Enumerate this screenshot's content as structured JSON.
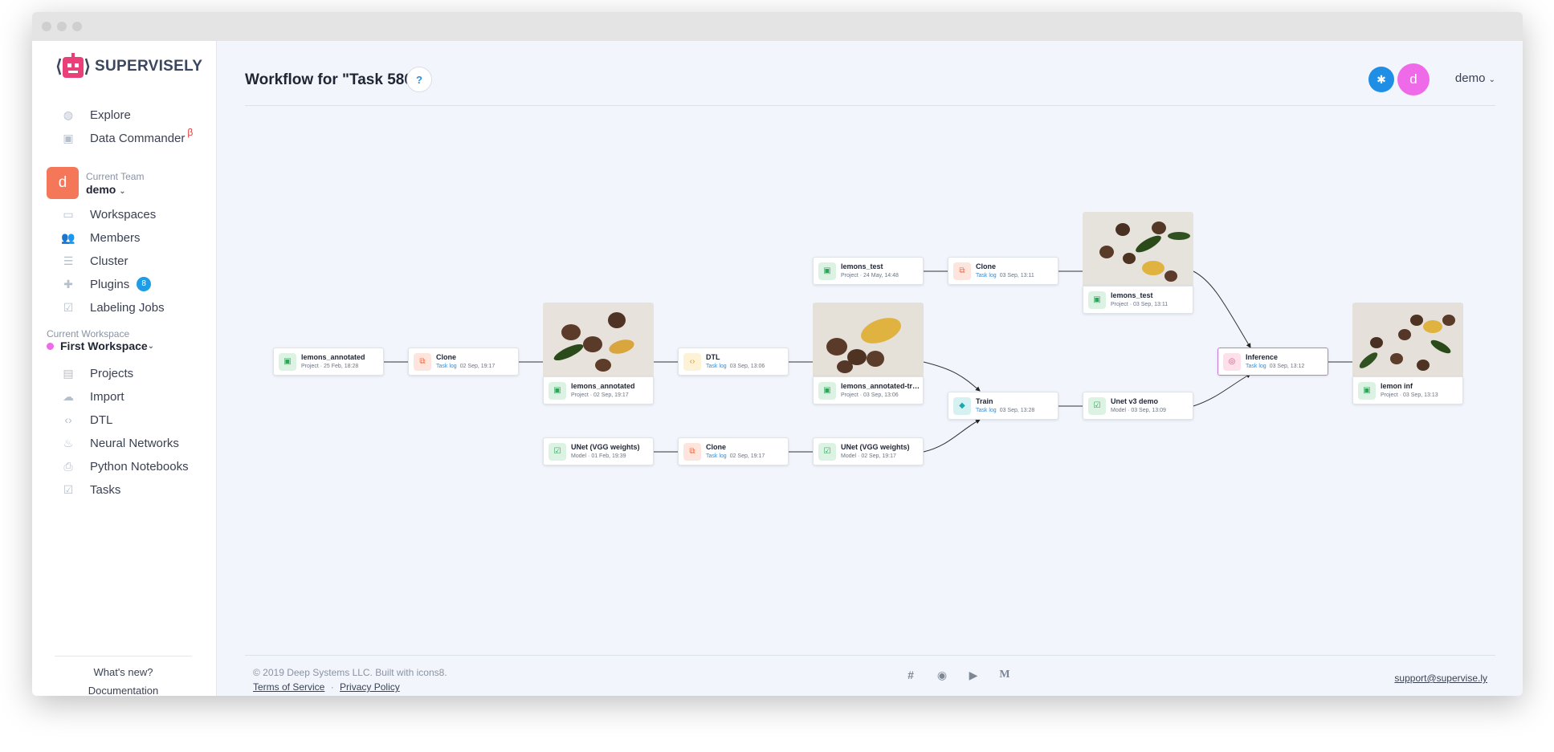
{
  "app": {
    "name": "SUPERVISELY"
  },
  "sidebar": {
    "top_items": [
      {
        "label": "Explore",
        "icon": "globe-icon"
      },
      {
        "label": "Data Commander",
        "icon": "folder-icon",
        "beta": "β"
      }
    ],
    "team": {
      "caption": "Current Team",
      "name": "demo",
      "avatar": "d"
    },
    "team_items": [
      {
        "label": "Workspaces",
        "icon": "monitor-icon"
      },
      {
        "label": "Members",
        "icon": "users-icon"
      },
      {
        "label": "Cluster",
        "icon": "cluster-icon"
      },
      {
        "label": "Plugins",
        "icon": "puzzle-icon",
        "badge": "8"
      },
      {
        "label": "Labeling Jobs",
        "icon": "check-icon"
      }
    ],
    "workspace": {
      "caption": "Current Workspace",
      "name": "First Workspace"
    },
    "workspace_items": [
      {
        "label": "Projects",
        "icon": "images-icon"
      },
      {
        "label": "Import",
        "icon": "cloud-upload-icon"
      },
      {
        "label": "DTL",
        "icon": "code-icon"
      },
      {
        "label": "Neural Networks",
        "icon": "flame-icon"
      },
      {
        "label": "Python Notebooks",
        "icon": "printer-icon"
      },
      {
        "label": "Tasks",
        "icon": "check-icon"
      }
    ],
    "footer": {
      "whats_new": "What's new?",
      "docs": "Documentation"
    }
  },
  "header": {
    "title": "Workflow for \"Task 580\"",
    "help": "?",
    "user_avatar": "d",
    "user_name": "demo"
  },
  "graph": {
    "nodes": [
      {
        "id": "n1",
        "title": "lemons_annotated",
        "kind": "Project",
        "date": "25 Feb, 18:28",
        "icon": "green"
      },
      {
        "id": "n2",
        "title": "Clone",
        "kind": "Task log",
        "date": "02 Sep, 19:17",
        "icon": "orange"
      },
      {
        "id": "n3",
        "title": "lemons_annotated",
        "kind": "Project",
        "date": "02 Sep, 19:17",
        "icon": "green"
      },
      {
        "id": "n4",
        "title": "DTL",
        "kind": "Task log",
        "date": "03 Sep, 13:06",
        "icon": "yellow"
      },
      {
        "id": "n5",
        "title": "lemons_annotated-trai...",
        "kind": "Project",
        "date": "03 Sep, 13:06",
        "icon": "green"
      },
      {
        "id": "n6",
        "title": "lemons_test",
        "kind": "Project",
        "date": "24 May, 14:48",
        "icon": "green"
      },
      {
        "id": "n7",
        "title": "Clone",
        "kind": "Task log",
        "date": "03 Sep, 13:11",
        "icon": "orange"
      },
      {
        "id": "n8",
        "title": "lemons_test",
        "kind": "Project",
        "date": "03 Sep, 13:11",
        "icon": "green"
      },
      {
        "id": "n9",
        "title": "Train",
        "kind": "Task log",
        "date": "03 Sep, 13:28",
        "icon": "teal"
      },
      {
        "id": "n10",
        "title": "Unet v3 demo",
        "kind": "Model",
        "date": "03 Sep, 13:09",
        "icon": "green"
      },
      {
        "id": "n11",
        "title": "Inference",
        "kind": "Task log",
        "date": "03 Sep, 13:12",
        "icon": "pink"
      },
      {
        "id": "n12",
        "title": "lemon inf",
        "kind": "Project",
        "date": "03 Sep, 13:13",
        "icon": "green"
      },
      {
        "id": "n13",
        "title": "UNet (VGG weights)",
        "kind": "Model",
        "date": "01 Feb, 19:39",
        "icon": "green"
      },
      {
        "id": "n14",
        "title": "Clone",
        "kind": "Task log",
        "date": "02 Sep, 19:17",
        "icon": "orange"
      },
      {
        "id": "n15",
        "title": "UNet (VGG weights)",
        "kind": "Model",
        "date": "02 Sep, 19:17",
        "icon": "green"
      }
    ]
  },
  "footer": {
    "copyright": "© 2019 Deep Systems LLC. Built with icons8.",
    "terms": "Terms of Service",
    "separator": "·",
    "privacy": "Privacy Policy",
    "support": "support@supervise.ly",
    "social": [
      "slack-icon",
      "github-icon",
      "youtube-icon",
      "medium-icon"
    ]
  },
  "colors": {
    "accent": "#1e9ce5",
    "team_avatar": "#f4775a",
    "user_avatar": "#ef6ae8",
    "selected_node": "#c978d8"
  }
}
